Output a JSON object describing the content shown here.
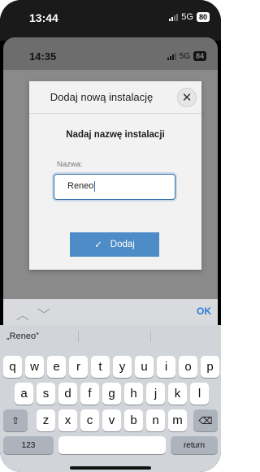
{
  "outer_status": {
    "time": "13:44",
    "network": "5G",
    "battery": "80"
  },
  "inner_status": {
    "time": "14:35",
    "network": "5G",
    "battery": "84"
  },
  "dialog": {
    "title": "Dodaj nową instalację",
    "close_glyph": "✕",
    "subtitle": "Nadaj nazwę instalacji",
    "field_label": "Nazwa:",
    "field_value": "Reneo",
    "submit_label": "Dodaj",
    "submit_icon": "✓"
  },
  "accessory": {
    "up_glyph": "︿",
    "down_glyph": "﹀",
    "ok_label": "OK"
  },
  "keyboard": {
    "suggestion": "„Reneo”",
    "row1": [
      "q",
      "w",
      "e",
      "r",
      "t",
      "y",
      "u",
      "i",
      "o",
      "p"
    ],
    "row2": [
      "a",
      "s",
      "d",
      "f",
      "g",
      "h",
      "j",
      "k",
      "l"
    ],
    "row3": [
      "z",
      "x",
      "c",
      "v",
      "b",
      "n",
      "m"
    ],
    "shift_glyph": "⇧",
    "backspace_glyph": "⌫",
    "numbers_label": "123",
    "return_label": "return"
  },
  "colors": {
    "accent": "#4e8cc8",
    "ok": "#2a7cd8"
  }
}
